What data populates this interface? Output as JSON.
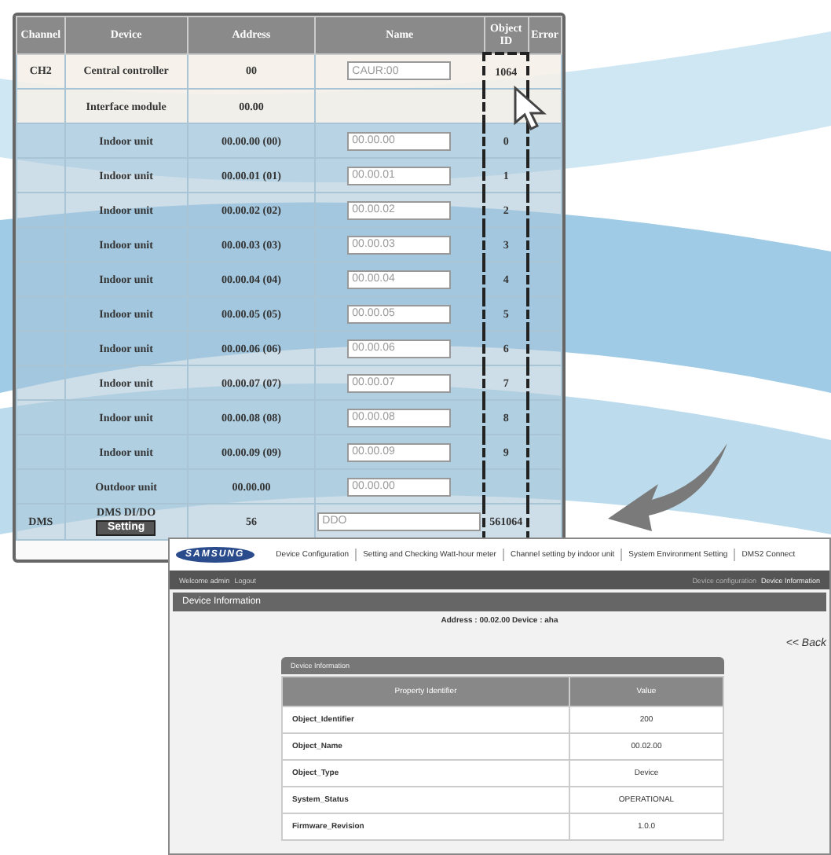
{
  "device_table": {
    "columns": [
      "Channel",
      "Device",
      "Address",
      "Name",
      "Object ID",
      "Error"
    ],
    "rows": [
      {
        "channel": "CH2",
        "device": "Central controller",
        "address": "00",
        "name": "CAUR:00",
        "object_id": "1064"
      },
      {
        "device": "Interface module",
        "address": "00.00"
      },
      {
        "device": "Indoor unit",
        "address": "00.00.00 (00)",
        "name": "00.00.00",
        "object_id": "0"
      },
      {
        "device": "Indoor unit",
        "address": "00.00.01 (01)",
        "name": "00.00.01",
        "object_id": "1"
      },
      {
        "device": "Indoor unit",
        "address": "00.00.02 (02)",
        "name": "00.00.02",
        "object_id": "2"
      },
      {
        "device": "Indoor unit",
        "address": "00.00.03 (03)",
        "name": "00.00.03",
        "object_id": "3"
      },
      {
        "device": "Indoor unit",
        "address": "00.00.04 (04)",
        "name": "00.00.04",
        "object_id": "4"
      },
      {
        "device": "Indoor unit",
        "address": "00.00.05 (05)",
        "name": "00.00.05",
        "object_id": "5"
      },
      {
        "device": "Indoor unit",
        "address": "00.00.06 (06)",
        "name": "00.00.06",
        "object_id": "6"
      },
      {
        "device": "Indoor unit",
        "address": "00.00.07 (07)",
        "name": "00.00.07",
        "object_id": "7"
      },
      {
        "device": "Indoor unit",
        "address": "00.00.08 (08)",
        "name": "00.00.08",
        "object_id": "8"
      },
      {
        "device": "Indoor unit",
        "address": "00.00.09 (09)",
        "name": "00.00.09",
        "object_id": "9"
      },
      {
        "device": "Outdoor unit",
        "address": "00.00.00",
        "name": "00.00.00"
      },
      {
        "channel": "DMS",
        "device": "DMS DI/DO",
        "button": "Setting",
        "address": "56",
        "name": "DDO",
        "object_id": "561064"
      }
    ]
  },
  "web_page": {
    "logo": "SAMSUNG",
    "menu": [
      "Device Configuration",
      "Setting and Checking Watt-hour meter",
      "Channel setting by indoor unit",
      "System Environment Setting",
      "DMS2 Connect"
    ],
    "welcome": "Welcome admin",
    "logout": "Logout",
    "breadcrumb": [
      "Device configuration",
      "Device Information"
    ],
    "title": "Device Information",
    "address_line": "Address : 00.02.00   Device : aha",
    "back": "<< Back",
    "panel_title": "Device Information",
    "columns": [
      "Property Identifier",
      "Value"
    ],
    "rows": [
      {
        "property": "Object_Identifier",
        "value": "200"
      },
      {
        "property": "Object_Name",
        "value": "00.02.00"
      },
      {
        "property": "Object_Type",
        "value": "Device"
      },
      {
        "property": "System_Status",
        "value": "OPERATIONAL"
      },
      {
        "property": "Firmware_Revision",
        "value": "1.0.0"
      }
    ]
  }
}
